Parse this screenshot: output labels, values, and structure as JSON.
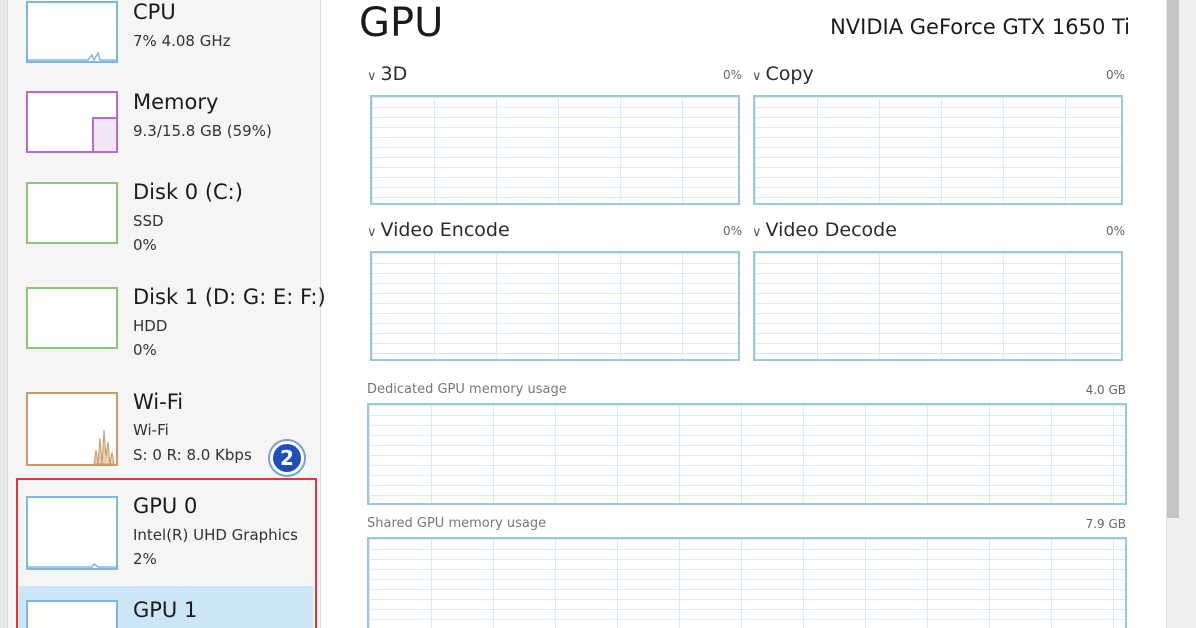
{
  "sidebar": {
    "items": [
      {
        "title": "CPU",
        "line1": "7% 4.08 GHz",
        "line2": ""
      },
      {
        "title": "Memory",
        "line1": "9.3/15.8 GB (59%)",
        "line2": ""
      },
      {
        "title": "Disk 0 (C:)",
        "line1": "SSD",
        "line2": "0%"
      },
      {
        "title": "Disk 1 (D: G: E: F:)",
        "line1": "HDD",
        "line2": "0%"
      },
      {
        "title": "Wi-Fi",
        "line1": "Wi-Fi",
        "line2": "S: 0 R: 8.0 Kbps"
      },
      {
        "title": "GPU 0",
        "line1": "Intel(R) UHD Graphics",
        "line2": "2%"
      },
      {
        "title": "GPU 1",
        "line1": "",
        "line2": ""
      }
    ],
    "badge": "2"
  },
  "main": {
    "title": "GPU",
    "device": "NVIDIA GeForce GTX 1650 Ti",
    "engines": [
      {
        "label": "3D",
        "pct": "0%"
      },
      {
        "label": "Copy",
        "pct": "0%"
      },
      {
        "label": "Video Encode",
        "pct": "0%"
      },
      {
        "label": "Video Decode",
        "pct": "0%"
      }
    ],
    "dedicated": {
      "label": "Dedicated GPU memory usage",
      "value": "4.0 GB"
    },
    "shared": {
      "label": "Shared GPU memory usage",
      "value": "7.9 GB"
    }
  },
  "colors": {
    "cpu": "#7fb7df",
    "memory": "#b46cc9",
    "disk": "#8fc77a",
    "wifi": "#c99a6a",
    "gpu": "#7fb7df",
    "highlight": "#e0383a",
    "badge": "#1f4fb6"
  }
}
